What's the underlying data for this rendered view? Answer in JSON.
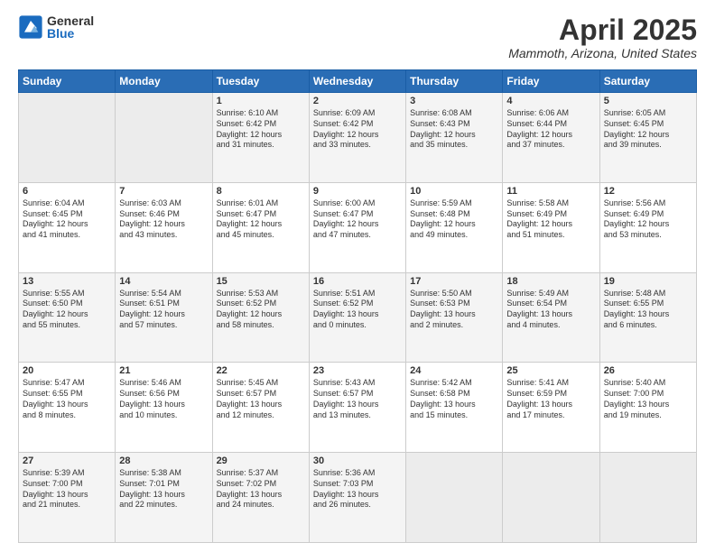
{
  "header": {
    "logo_general": "General",
    "logo_blue": "Blue",
    "month_title": "April 2025",
    "location": "Mammoth, Arizona, United States"
  },
  "days_of_week": [
    "Sunday",
    "Monday",
    "Tuesday",
    "Wednesday",
    "Thursday",
    "Friday",
    "Saturday"
  ],
  "weeks": [
    [
      {
        "day": "",
        "info": ""
      },
      {
        "day": "",
        "info": ""
      },
      {
        "day": "1",
        "info": "Sunrise: 6:10 AM\nSunset: 6:42 PM\nDaylight: 12 hours\nand 31 minutes."
      },
      {
        "day": "2",
        "info": "Sunrise: 6:09 AM\nSunset: 6:42 PM\nDaylight: 12 hours\nand 33 minutes."
      },
      {
        "day": "3",
        "info": "Sunrise: 6:08 AM\nSunset: 6:43 PM\nDaylight: 12 hours\nand 35 minutes."
      },
      {
        "day": "4",
        "info": "Sunrise: 6:06 AM\nSunset: 6:44 PM\nDaylight: 12 hours\nand 37 minutes."
      },
      {
        "day": "5",
        "info": "Sunrise: 6:05 AM\nSunset: 6:45 PM\nDaylight: 12 hours\nand 39 minutes."
      }
    ],
    [
      {
        "day": "6",
        "info": "Sunrise: 6:04 AM\nSunset: 6:45 PM\nDaylight: 12 hours\nand 41 minutes."
      },
      {
        "day": "7",
        "info": "Sunrise: 6:03 AM\nSunset: 6:46 PM\nDaylight: 12 hours\nand 43 minutes."
      },
      {
        "day": "8",
        "info": "Sunrise: 6:01 AM\nSunset: 6:47 PM\nDaylight: 12 hours\nand 45 minutes."
      },
      {
        "day": "9",
        "info": "Sunrise: 6:00 AM\nSunset: 6:47 PM\nDaylight: 12 hours\nand 47 minutes."
      },
      {
        "day": "10",
        "info": "Sunrise: 5:59 AM\nSunset: 6:48 PM\nDaylight: 12 hours\nand 49 minutes."
      },
      {
        "day": "11",
        "info": "Sunrise: 5:58 AM\nSunset: 6:49 PM\nDaylight: 12 hours\nand 51 minutes."
      },
      {
        "day": "12",
        "info": "Sunrise: 5:56 AM\nSunset: 6:49 PM\nDaylight: 12 hours\nand 53 minutes."
      }
    ],
    [
      {
        "day": "13",
        "info": "Sunrise: 5:55 AM\nSunset: 6:50 PM\nDaylight: 12 hours\nand 55 minutes."
      },
      {
        "day": "14",
        "info": "Sunrise: 5:54 AM\nSunset: 6:51 PM\nDaylight: 12 hours\nand 57 minutes."
      },
      {
        "day": "15",
        "info": "Sunrise: 5:53 AM\nSunset: 6:52 PM\nDaylight: 12 hours\nand 58 minutes."
      },
      {
        "day": "16",
        "info": "Sunrise: 5:51 AM\nSunset: 6:52 PM\nDaylight: 13 hours\nand 0 minutes."
      },
      {
        "day": "17",
        "info": "Sunrise: 5:50 AM\nSunset: 6:53 PM\nDaylight: 13 hours\nand 2 minutes."
      },
      {
        "day": "18",
        "info": "Sunrise: 5:49 AM\nSunset: 6:54 PM\nDaylight: 13 hours\nand 4 minutes."
      },
      {
        "day": "19",
        "info": "Sunrise: 5:48 AM\nSunset: 6:55 PM\nDaylight: 13 hours\nand 6 minutes."
      }
    ],
    [
      {
        "day": "20",
        "info": "Sunrise: 5:47 AM\nSunset: 6:55 PM\nDaylight: 13 hours\nand 8 minutes."
      },
      {
        "day": "21",
        "info": "Sunrise: 5:46 AM\nSunset: 6:56 PM\nDaylight: 13 hours\nand 10 minutes."
      },
      {
        "day": "22",
        "info": "Sunrise: 5:45 AM\nSunset: 6:57 PM\nDaylight: 13 hours\nand 12 minutes."
      },
      {
        "day": "23",
        "info": "Sunrise: 5:43 AM\nSunset: 6:57 PM\nDaylight: 13 hours\nand 13 minutes."
      },
      {
        "day": "24",
        "info": "Sunrise: 5:42 AM\nSunset: 6:58 PM\nDaylight: 13 hours\nand 15 minutes."
      },
      {
        "day": "25",
        "info": "Sunrise: 5:41 AM\nSunset: 6:59 PM\nDaylight: 13 hours\nand 17 minutes."
      },
      {
        "day": "26",
        "info": "Sunrise: 5:40 AM\nSunset: 7:00 PM\nDaylight: 13 hours\nand 19 minutes."
      }
    ],
    [
      {
        "day": "27",
        "info": "Sunrise: 5:39 AM\nSunset: 7:00 PM\nDaylight: 13 hours\nand 21 minutes."
      },
      {
        "day": "28",
        "info": "Sunrise: 5:38 AM\nSunset: 7:01 PM\nDaylight: 13 hours\nand 22 minutes."
      },
      {
        "day": "29",
        "info": "Sunrise: 5:37 AM\nSunset: 7:02 PM\nDaylight: 13 hours\nand 24 minutes."
      },
      {
        "day": "30",
        "info": "Sunrise: 5:36 AM\nSunset: 7:03 PM\nDaylight: 13 hours\nand 26 minutes."
      },
      {
        "day": "",
        "info": ""
      },
      {
        "day": "",
        "info": ""
      },
      {
        "day": "",
        "info": ""
      }
    ]
  ]
}
